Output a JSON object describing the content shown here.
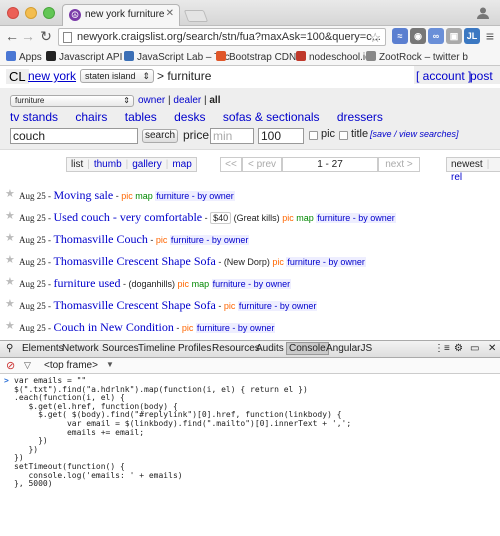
{
  "browser": {
    "tab_title": "new york furniture \"couch",
    "tab_favicon": "☮",
    "url": "newyork.craigslist.org/search/stn/fua?maxAsk=100&query=c..."
  },
  "bookmarks": [
    {
      "label": "Apps",
      "icon": "apps-grid-icon",
      "color": "#4a77d4"
    },
    {
      "label": "Javascript API",
      "icon": "bolt-icon",
      "color": "#222"
    },
    {
      "label": "JavaScript Lab – Toc",
      "icon": "page-icon",
      "color": "#3b6fb6"
    },
    {
      "label": "Bootstrap CDN",
      "icon": "bootstrap-icon",
      "color": "#e0572a"
    },
    {
      "label": "nodeschool.io",
      "icon": "node-icon",
      "color": "#c0392b"
    },
    {
      "label": "ZootRock – twitter b",
      "icon": "zootrock-icon",
      "color": "#888"
    }
  ],
  "craigslist": {
    "logo": "CL",
    "city": "new york",
    "borough": "staten island",
    "crumb": "> furniture",
    "account": "[ account ]",
    "post": "post",
    "category": "furniture",
    "owner": "owner",
    "dealer": "dealer",
    "all": "all",
    "subcategories": [
      "tv stands",
      "chairs",
      "tables",
      "desks",
      "sofas & sectionals",
      "dressers"
    ],
    "query": "couch",
    "search_button": "search",
    "price_label": "price:",
    "min_placeholder": "min",
    "max_value": "100",
    "pic_label": "pic",
    "title_label": "title",
    "saved_searches": "[save / view searches]"
  },
  "pagination": {
    "views": [
      "list",
      "thumb",
      "gallery",
      "map"
    ],
    "first": "<<",
    "prev": "< prev",
    "range": "1 - 27",
    "next": "next >",
    "sort_newest": "newest",
    "sort_rel": "rel"
  },
  "listings": [
    {
      "date": "Aug 25 -",
      "title": "Moving sale",
      "price": "",
      "location": "",
      "pic": "pic",
      "map": "map",
      "category": "furniture - by owner"
    },
    {
      "date": "Aug 25 -",
      "title": "Used couch - very comfortable",
      "price": "$40",
      "location": "(Great kills)",
      "pic": "pic",
      "map": "map",
      "category": "furniture - by owner"
    },
    {
      "date": "Aug 25 -",
      "title": "Thomasville Couch",
      "price": "",
      "location": "",
      "pic": "pic",
      "map": "",
      "category": "furniture - by owner"
    },
    {
      "date": "Aug 25 -",
      "title": "Thomasville Crescent Shape Sofa",
      "price": "",
      "location": "(New Dorp)",
      "pic": "pic",
      "map": "",
      "category": "furniture - by owner"
    },
    {
      "date": "Aug 25 -",
      "title": "furniture used",
      "price": "",
      "location": "(doganhills)",
      "pic": "pic",
      "map": "map",
      "category": "furniture - by owner"
    },
    {
      "date": "Aug 25 -",
      "title": "Thomasville Crescent Shape Sofa",
      "price": "",
      "location": "",
      "pic": "pic",
      "map": "",
      "category": "furniture - by owner"
    },
    {
      "date": "Aug 25 -",
      "title": "Couch in New Condition",
      "price": "",
      "location": "",
      "pic": "pic",
      "map": "",
      "category": "furniture - by owner"
    }
  ],
  "devtools": {
    "tabs": [
      "Elements",
      "Network",
      "Sources",
      "Timeline",
      "Profiles",
      "Resources",
      "Audits",
      "Console",
      "AngularJS"
    ],
    "active_tab": "Console",
    "frame": "<top frame>",
    "code": "var emails = \"\"\n$(\".txt\").find(\"a.hdrlnk\").map(function(i, el) { return el })\n.each(function(i, el) {\n   $.get(el.href, function(body) {\n     $.get( $(body).find(\"#replylink\")[0].href, function(linkbody) {\n           var email = $(linkbody).find(\".mailto\")[0].innerText + ',';\n           emails += email;\n     })\n   })\n})\nsetTimeout(function() {\n   console.log('emails: ' + emails)\n}, 5000)"
  }
}
